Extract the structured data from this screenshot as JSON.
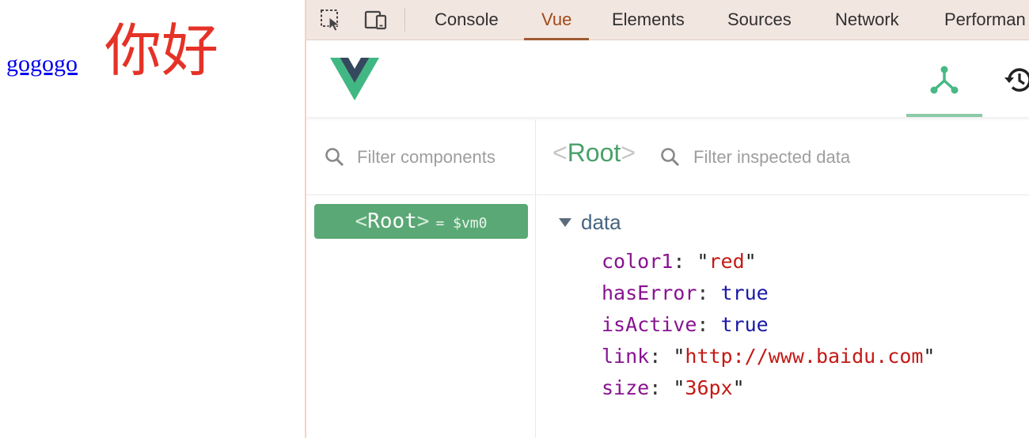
{
  "page": {
    "link_text": "gogogo",
    "greeting": "你好",
    "greeting_color": "#e53227"
  },
  "devtools": {
    "tools": [
      {
        "icon": "inspect-element-icon"
      },
      {
        "icon": "device-toolbar-icon"
      }
    ],
    "tabs": [
      {
        "label": "Console",
        "active": false
      },
      {
        "label": "Vue",
        "active": true
      },
      {
        "label": "Elements",
        "active": false
      },
      {
        "label": "Sources",
        "active": false
      },
      {
        "label": "Network",
        "active": false
      },
      {
        "label": "Performan",
        "active": false
      }
    ],
    "accent_color": "#a04a16"
  },
  "vue": {
    "logo": "vue-logo-icon",
    "nav": [
      {
        "icon": "components-tree-icon",
        "active": true
      },
      {
        "icon": "history-icon",
        "active": false
      }
    ],
    "components_filter_placeholder": "Filter components",
    "breadcrumb": {
      "open": "<",
      "name": "Root",
      "close": ">"
    },
    "inspector_filter_placeholder": "Filter inspected data",
    "tree": [
      {
        "open": "<",
        "name": "Root",
        "close": ">",
        "vm_ref": "= $vm0",
        "selected": true
      }
    ],
    "section": {
      "label": "data",
      "expanded": true
    },
    "data": [
      {
        "key": "color1",
        "value": "red",
        "type": "string"
      },
      {
        "key": "hasError",
        "value": "true",
        "type": "boolean"
      },
      {
        "key": "isActive",
        "value": "true",
        "type": "boolean"
      },
      {
        "key": "link",
        "value": "http://www.baidu.com",
        "type": "string"
      },
      {
        "key": "size",
        "value": "36px",
        "type": "string"
      }
    ],
    "brand_color": "#5aa875"
  }
}
